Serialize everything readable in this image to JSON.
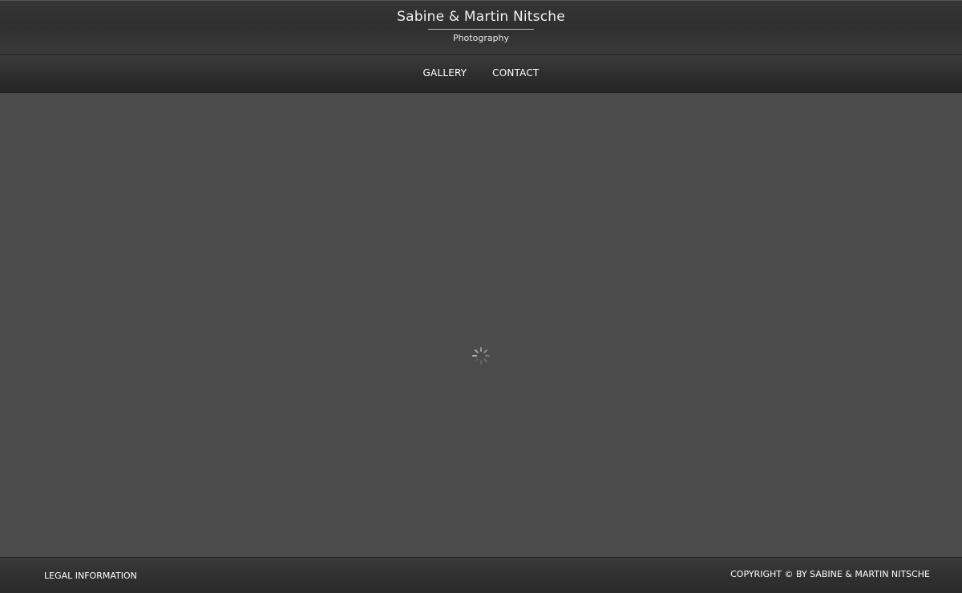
{
  "header": {
    "title": "Sabine & Martin Nitsche",
    "subtitle": "Photography"
  },
  "nav": {
    "items": [
      {
        "label": "GALLERY"
      },
      {
        "label": "CONTACT"
      }
    ]
  },
  "main": {
    "loading_icon": "spinner-icon"
  },
  "footer": {
    "legal_label": "LEGAL INFORMATION",
    "copyright": "COPYRIGHT © BY SABINE & MARTIN NITSCHE"
  },
  "colors": {
    "background": "#4b4b4b",
    "bar_dark": "#2f2f2f",
    "text": "#ffffff"
  }
}
